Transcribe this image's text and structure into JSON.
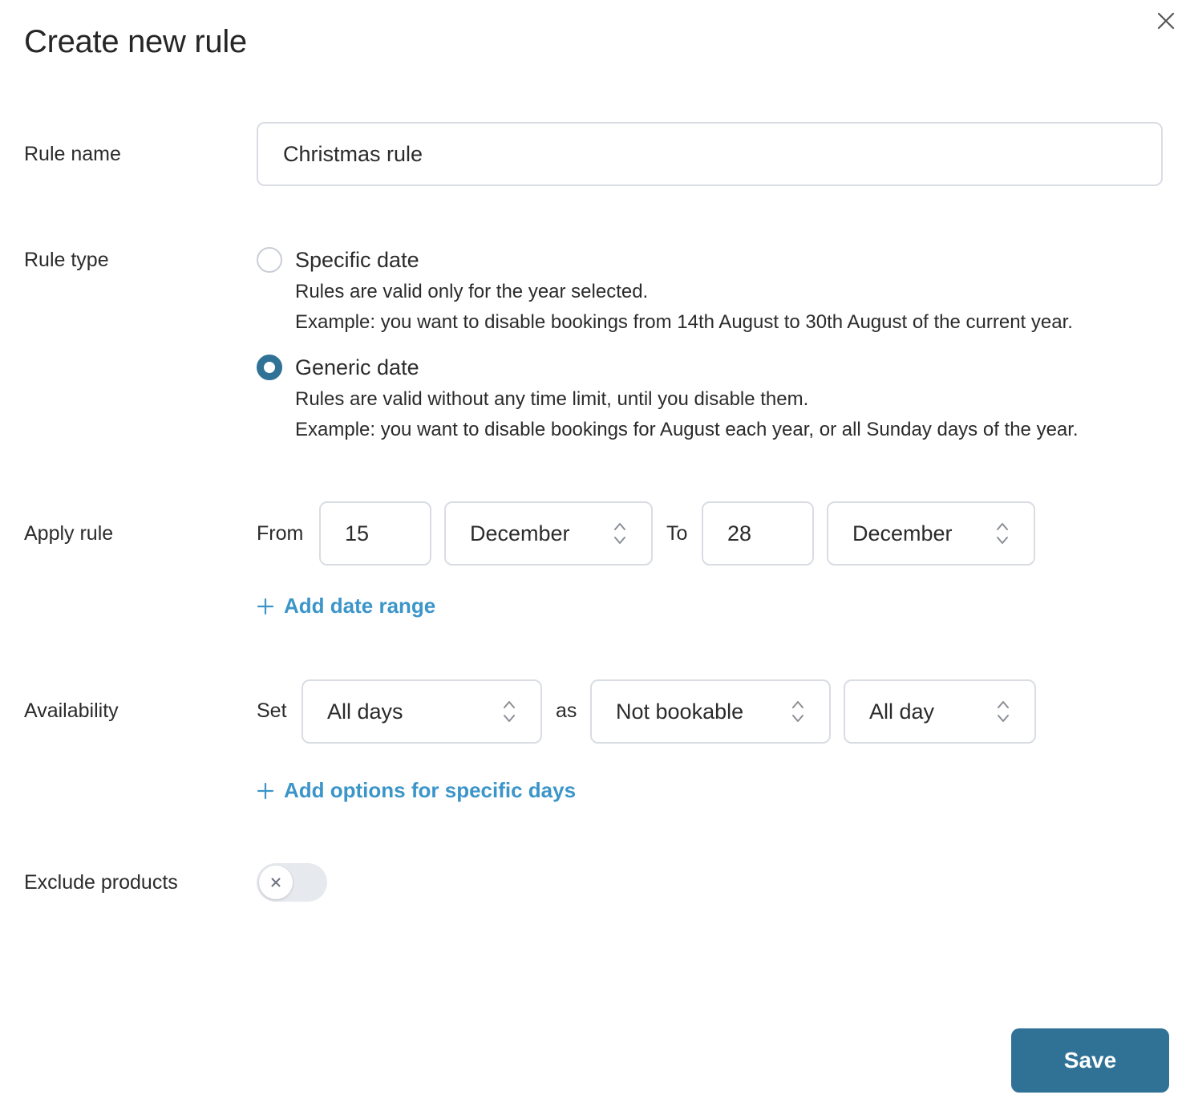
{
  "modal": {
    "title": "Create new rule",
    "close_icon": "close-icon"
  },
  "rule_name": {
    "label": "Rule name",
    "value": "Christmas rule"
  },
  "rule_type": {
    "label": "Rule type",
    "selected": "generic",
    "options": [
      {
        "id": "specific",
        "label": "Specific date",
        "desc1": "Rules are valid only for the year selected.",
        "desc2": "Example: you want to disable bookings from 14th August to 30th August of the current year."
      },
      {
        "id": "generic",
        "label": "Generic date",
        "desc1": "Rules are valid without any time limit, until you disable them.",
        "desc2": "Example: you want to disable bookings for August each year, or all Sunday days of the year."
      }
    ]
  },
  "apply_rule": {
    "label": "Apply rule",
    "from_label": "From",
    "from_day": "15",
    "from_month": "December",
    "to_label": "To",
    "to_day": "28",
    "to_month": "December",
    "add_label": "Add date range"
  },
  "availability": {
    "label": "Availability",
    "set_label": "Set",
    "days": "All days",
    "as_label": "as",
    "status": "Not bookable",
    "time": "All day",
    "add_label": "Add options for specific days"
  },
  "exclude_products": {
    "label": "Exclude products",
    "enabled": false
  },
  "footer": {
    "save_label": "Save"
  },
  "colors": {
    "primary": "#2f7296",
    "link": "#3b95c9",
    "border": "#d9dde3",
    "toggle_off": "#e6e9ee"
  }
}
